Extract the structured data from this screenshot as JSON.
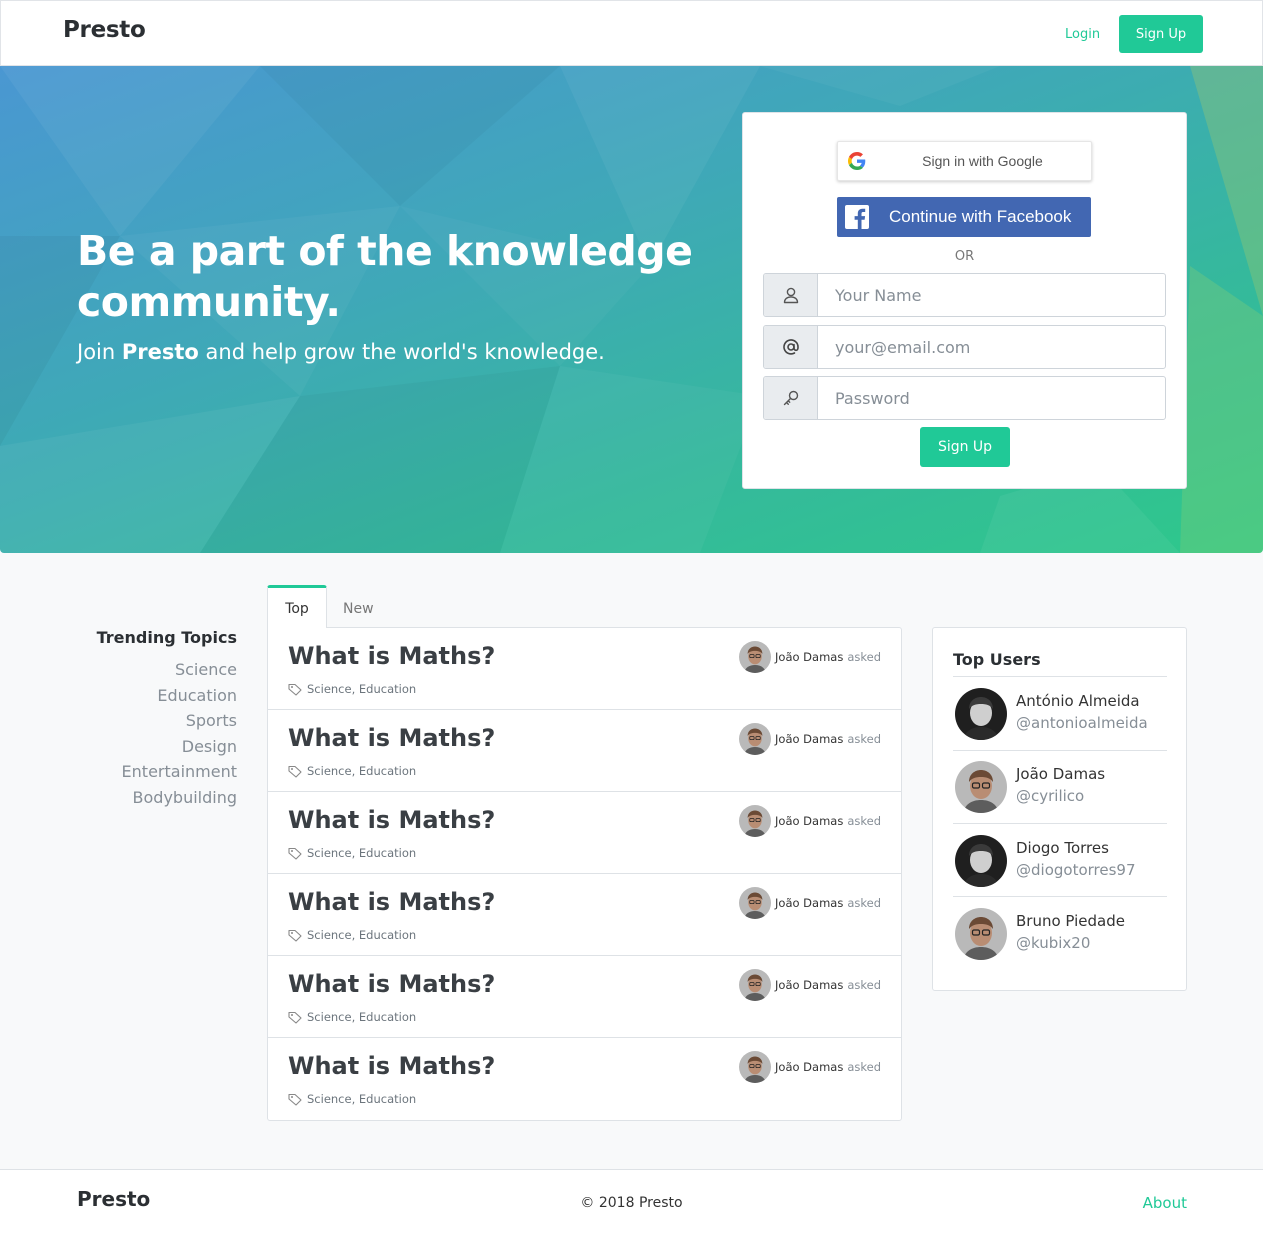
{
  "navbar": {
    "brand": "Presto",
    "login": "Login",
    "signup": "Sign Up"
  },
  "hero": {
    "title": "Be a part of the knowledge community.",
    "subtitle_pre": "Join ",
    "subtitle_brand": "Presto",
    "subtitle_post": " and help grow the world's knowledge."
  },
  "signup_card": {
    "google_label": "Sign in with Google",
    "facebook_label": "Continue with Facebook",
    "or_label": "OR",
    "name_placeholder": "Your Name",
    "email_placeholder": "your@email.com",
    "password_placeholder": "Password",
    "submit_label": "Sign Up",
    "icons": [
      "user-icon",
      "at-icon",
      "key-icon"
    ]
  },
  "trending": {
    "title": "Trending Topics",
    "topics": [
      "Science",
      "Education",
      "Sports",
      "Design",
      "Entertainment",
      "Bodybuilding"
    ]
  },
  "tabs": [
    {
      "label": "Top",
      "active": true
    },
    {
      "label": "New",
      "active": false
    }
  ],
  "questions": [
    {
      "title": "What is Maths?",
      "tags": "Science, Education",
      "author": "João Damas",
      "action": "asked"
    },
    {
      "title": "What is Maths?",
      "tags": "Science, Education",
      "author": "João Damas",
      "action": "asked"
    },
    {
      "title": "What is Maths?",
      "tags": "Science, Education",
      "author": "João Damas",
      "action": "asked"
    },
    {
      "title": "What is Maths?",
      "tags": "Science, Education",
      "author": "João Damas",
      "action": "asked"
    },
    {
      "title": "What is Maths?",
      "tags": "Science, Education",
      "author": "João Damas",
      "action": "asked"
    },
    {
      "title": "What is Maths?",
      "tags": "Science, Education",
      "author": "João Damas",
      "action": "asked"
    }
  ],
  "top_users": {
    "title": "Top Users",
    "users": [
      {
        "name": "António Almeida",
        "handle": "@antonioalmeida"
      },
      {
        "name": "João Damas",
        "handle": "@cyrilico"
      },
      {
        "name": "Diogo Torres",
        "handle": "@diogotorres97"
      },
      {
        "name": "Bruno Piedade",
        "handle": "@kubix20"
      }
    ]
  },
  "footer": {
    "brand": "Presto",
    "copyright": "© 2018 Presto",
    "about": "About"
  },
  "colors": {
    "accent": "#20c997",
    "facebook": "#4267b2",
    "text_dark": "#2b2f33",
    "muted": "#868e96"
  }
}
